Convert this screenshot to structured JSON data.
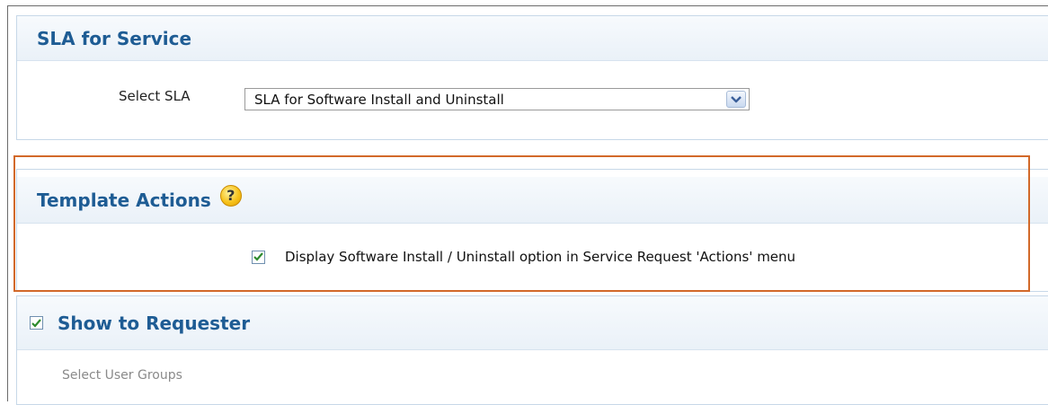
{
  "sla_section": {
    "title": "SLA for Service",
    "select_label": "Select SLA",
    "selected_value": "SLA for Software Install and Uninstall"
  },
  "template_actions": {
    "title": "Template Actions",
    "help_glyph": "?",
    "checkbox_label": "Display Software Install / Uninstall option in Service Request 'Actions' menu",
    "checkbox_checked": true
  },
  "show_to_requester": {
    "title": "Show to Requester",
    "checked": true,
    "user_groups_label": "Select User Groups"
  },
  "colors": {
    "title_blue": "#1e5c94",
    "highlight_orange": "#d2692a",
    "check_green": "#2e8b2e"
  },
  "icons": [
    "chevron-down-icon",
    "help-icon",
    "checkmark-icon"
  ]
}
